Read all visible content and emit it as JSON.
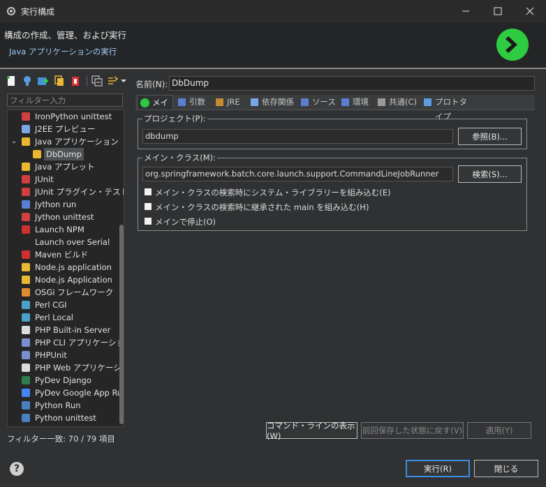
{
  "window": {
    "title": "実行構成"
  },
  "header": {
    "title": "構成の作成、管理、および実行",
    "subtitle": "Java アプリケーションの実行"
  },
  "filter": {
    "placeholder": "フィルター入力"
  },
  "tree": {
    "items": [
      {
        "label": "IronPython unittest",
        "icon": "ironpython-unittest-icon",
        "indent": 1
      },
      {
        "label": "J2EE プレビュー",
        "icon": "j2ee-preview-icon",
        "indent": 1
      },
      {
        "label": "Java アプリケーション",
        "icon": "java-app-icon",
        "indent": 1,
        "expanded": true
      },
      {
        "label": "DbDump",
        "icon": "java-config-icon",
        "indent": 2,
        "selected": true
      },
      {
        "label": "Java アプレット",
        "icon": "java-applet-icon",
        "indent": 1
      },
      {
        "label": "JUnit",
        "icon": "junit-icon",
        "indent": 1
      },
      {
        "label": "JUnit プラグイン・テスト",
        "icon": "junit-plugin-icon",
        "indent": 1
      },
      {
        "label": "Jython run",
        "icon": "jython-run-icon",
        "indent": 1
      },
      {
        "label": "Jython unittest",
        "icon": "jython-unittest-icon",
        "indent": 1
      },
      {
        "label": "Launch NPM",
        "icon": "npm-icon",
        "indent": 1
      },
      {
        "label": "Launch over Serial",
        "icon": "",
        "indent": 1
      },
      {
        "label": "Maven ビルド",
        "icon": "maven-icon",
        "indent": 1
      },
      {
        "label": "Node.js application",
        "icon": "nodejs-icon",
        "indent": 1
      },
      {
        "label": "Node.js Application",
        "icon": "nodejs-icon",
        "indent": 1
      },
      {
        "label": "OSGi フレームワーク",
        "icon": "osgi-icon",
        "indent": 1
      },
      {
        "label": "Perl CGI",
        "icon": "perl-icon",
        "indent": 1
      },
      {
        "label": "Perl Local",
        "icon": "perl-icon",
        "indent": 1
      },
      {
        "label": "PHP Built-in Server",
        "icon": "php-server-icon",
        "indent": 1
      },
      {
        "label": "PHP CLI アプリケーション",
        "icon": "php-cli-icon",
        "indent": 1
      },
      {
        "label": "PHPUnit",
        "icon": "phpunit-icon",
        "indent": 1
      },
      {
        "label": "PHP Web アプリケーション",
        "icon": "php-web-icon",
        "indent": 1
      },
      {
        "label": "PyDev Django",
        "icon": "django-icon",
        "indent": 1
      },
      {
        "label": "PyDev Google App Ru",
        "icon": "google-icon",
        "indent": 1
      },
      {
        "label": "Python Run",
        "icon": "python-icon",
        "indent": 1
      },
      {
        "label": "Python unittest",
        "icon": "python-unittest-icon",
        "indent": 1
      }
    ],
    "status": "フィルター一致: 70 / 79 項目"
  },
  "config": {
    "name_label": "名前(N):",
    "name_value": "DbDump",
    "tabs": [
      {
        "label": "メイン",
        "icon": "main-tab-icon",
        "active": true
      },
      {
        "label": "引数",
        "icon": "arguments-tab-icon"
      },
      {
        "label": "JRE",
        "icon": "jre-tab-icon"
      },
      {
        "label": "依存関係",
        "icon": "dependencies-tab-icon"
      },
      {
        "label": "ソース",
        "icon": "source-tab-icon"
      },
      {
        "label": "環境",
        "icon": "environment-tab-icon"
      },
      {
        "label": "共通(C)",
        "icon": "common-tab-icon"
      },
      {
        "label": "プロトタイプ",
        "icon": "prototype-tab-icon"
      }
    ],
    "project": {
      "legend": "プロジェクト(P):",
      "value": "dbdump",
      "browse": "参照(B)..."
    },
    "mainclass": {
      "legend": "メイン・クラス(M):",
      "value": "org.springframework.batch.core.launch.support.CommandLineJobRunner",
      "search": "検索(S)..."
    },
    "checks": [
      {
        "label": "メイン・クラスの検索時にシステム・ライブラリーを組み込む(E)",
        "checked": false
      },
      {
        "label": "メイン・クラスの検索時に継承された main を組み込む(H)",
        "checked": false
      },
      {
        "label": "メインで停止(O)",
        "checked": false
      }
    ],
    "buttons": {
      "show_cmd": "コマンド・ラインの表示(W)",
      "revert": "前回保存した状態に戻す(V)",
      "apply": "適用(Y)"
    }
  },
  "footer": {
    "run": "実行(R)",
    "close": "閉じる"
  }
}
